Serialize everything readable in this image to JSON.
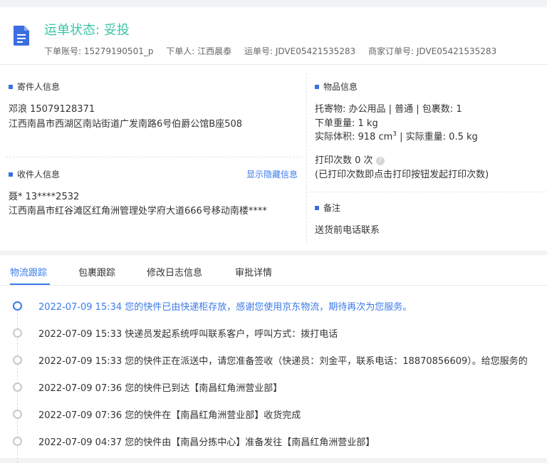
{
  "header": {
    "status_label": "运单状态:",
    "status_value": "妥投",
    "order_account": "下单账号: 15279190501_p",
    "orderer": "下单人: 江西晨泰",
    "waybill": "运单号: JDVE05421535283",
    "merchant_order": "商家订单号: JDVE05421535283",
    "icon": "document-icon"
  },
  "sender": {
    "title": "寄件人信息",
    "name_phone": "邓浪 15079128371",
    "address": "江西南昌市西湖区南站街道广发南路6号伯爵公馆B座508"
  },
  "receiver": {
    "title": "收件人信息",
    "show_hidden": "显示隐藏信息",
    "name_phone": "聂* 13****2532",
    "address": "江西南昌市红谷滩区红角洲管理处学府大道666号移动南楼****"
  },
  "goods": {
    "title": "物品信息",
    "line1": "托寄物: 办公用品 | 普通 | 包裹数: 1",
    "line2": "下单重量: 1 kg",
    "volume_prefix": "实际体积: 918 cm",
    "volume_sup": "3",
    "volume_suffix": " | 实际重量: 0.5 kg",
    "print_count": "打印次数 0 次",
    "print_note": "(已打印次数即点击打印按钮发起打印次数)"
  },
  "remark": {
    "title": "备注",
    "text": "送货前电话联系"
  },
  "tabs": [
    {
      "label": "物流跟踪"
    },
    {
      "label": "包裹跟踪"
    },
    {
      "label": "修改日志信息"
    },
    {
      "label": "审批详情"
    }
  ],
  "events": [
    {
      "text": "2022-07-09 15:34 您的快件已由快递柜存放，感谢您使用京东物流，期待再次为您服务。"
    },
    {
      "text": "2022-07-09 15:33 快递员发起系统呼叫联系客户，呼叫方式：拨打电话"
    },
    {
      "text": "2022-07-09 15:33 您的快件正在派送中，请您准备签收（快递员：刘金平，联系电话：18870856609）。给您服务的"
    },
    {
      "text": "2022-07-09 07:36 您的快件已到达【南昌红角洲营业部】"
    },
    {
      "text": "2022-07-09 07:36 您的快件在【南昌红角洲营业部】收货完成"
    },
    {
      "text": "2022-07-09 04:37 您的快件由【南昌分拣中心】准备发往【南昌红角洲营业部】"
    }
  ],
  "colors": {
    "accent": "#3b7be8",
    "status": "#39c5a5"
  }
}
